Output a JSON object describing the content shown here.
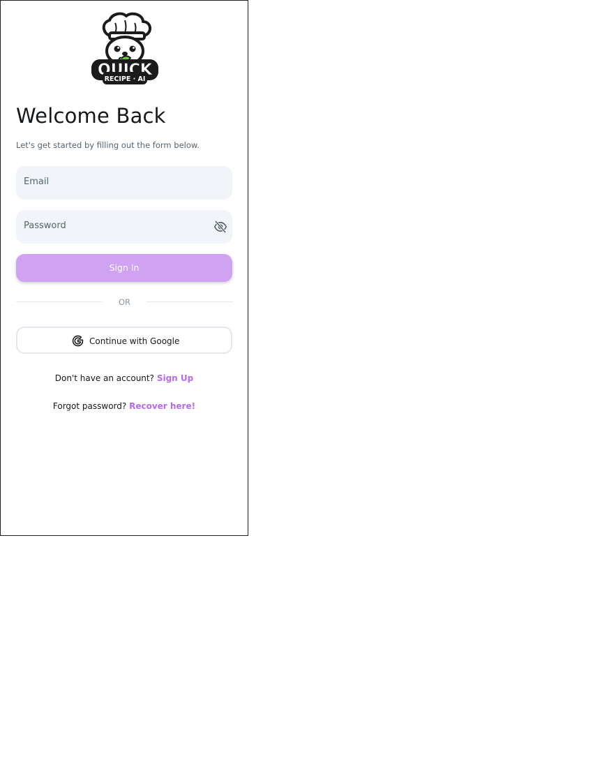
{
  "logo": {
    "icon": "chef-mascot-logo",
    "brand_line1": "QUICK",
    "brand_line2": "RECIPE AI"
  },
  "header": {
    "title": "Welcome Back",
    "subtitle": "Let's get started by filling out the form below."
  },
  "form": {
    "email_placeholder": "Email",
    "password_placeholder": "Password",
    "password_toggle_icon": "eye-off-icon",
    "signin_label": "Sign In"
  },
  "divider": {
    "label": "OR"
  },
  "social": {
    "google_label": "Continue with Google",
    "google_icon": "google-icon"
  },
  "footer": {
    "signup_prompt": "Don't have an account?",
    "signup_link": "Sign Up",
    "recover_prompt": "Forgot password?",
    "recover_link": "Recover here!"
  },
  "colors": {
    "accent": "#b46bee",
    "button": "#cfa3f2",
    "field_bg": "#f1f4f8",
    "text_primary": "#14181b",
    "text_secondary": "#57636c"
  }
}
